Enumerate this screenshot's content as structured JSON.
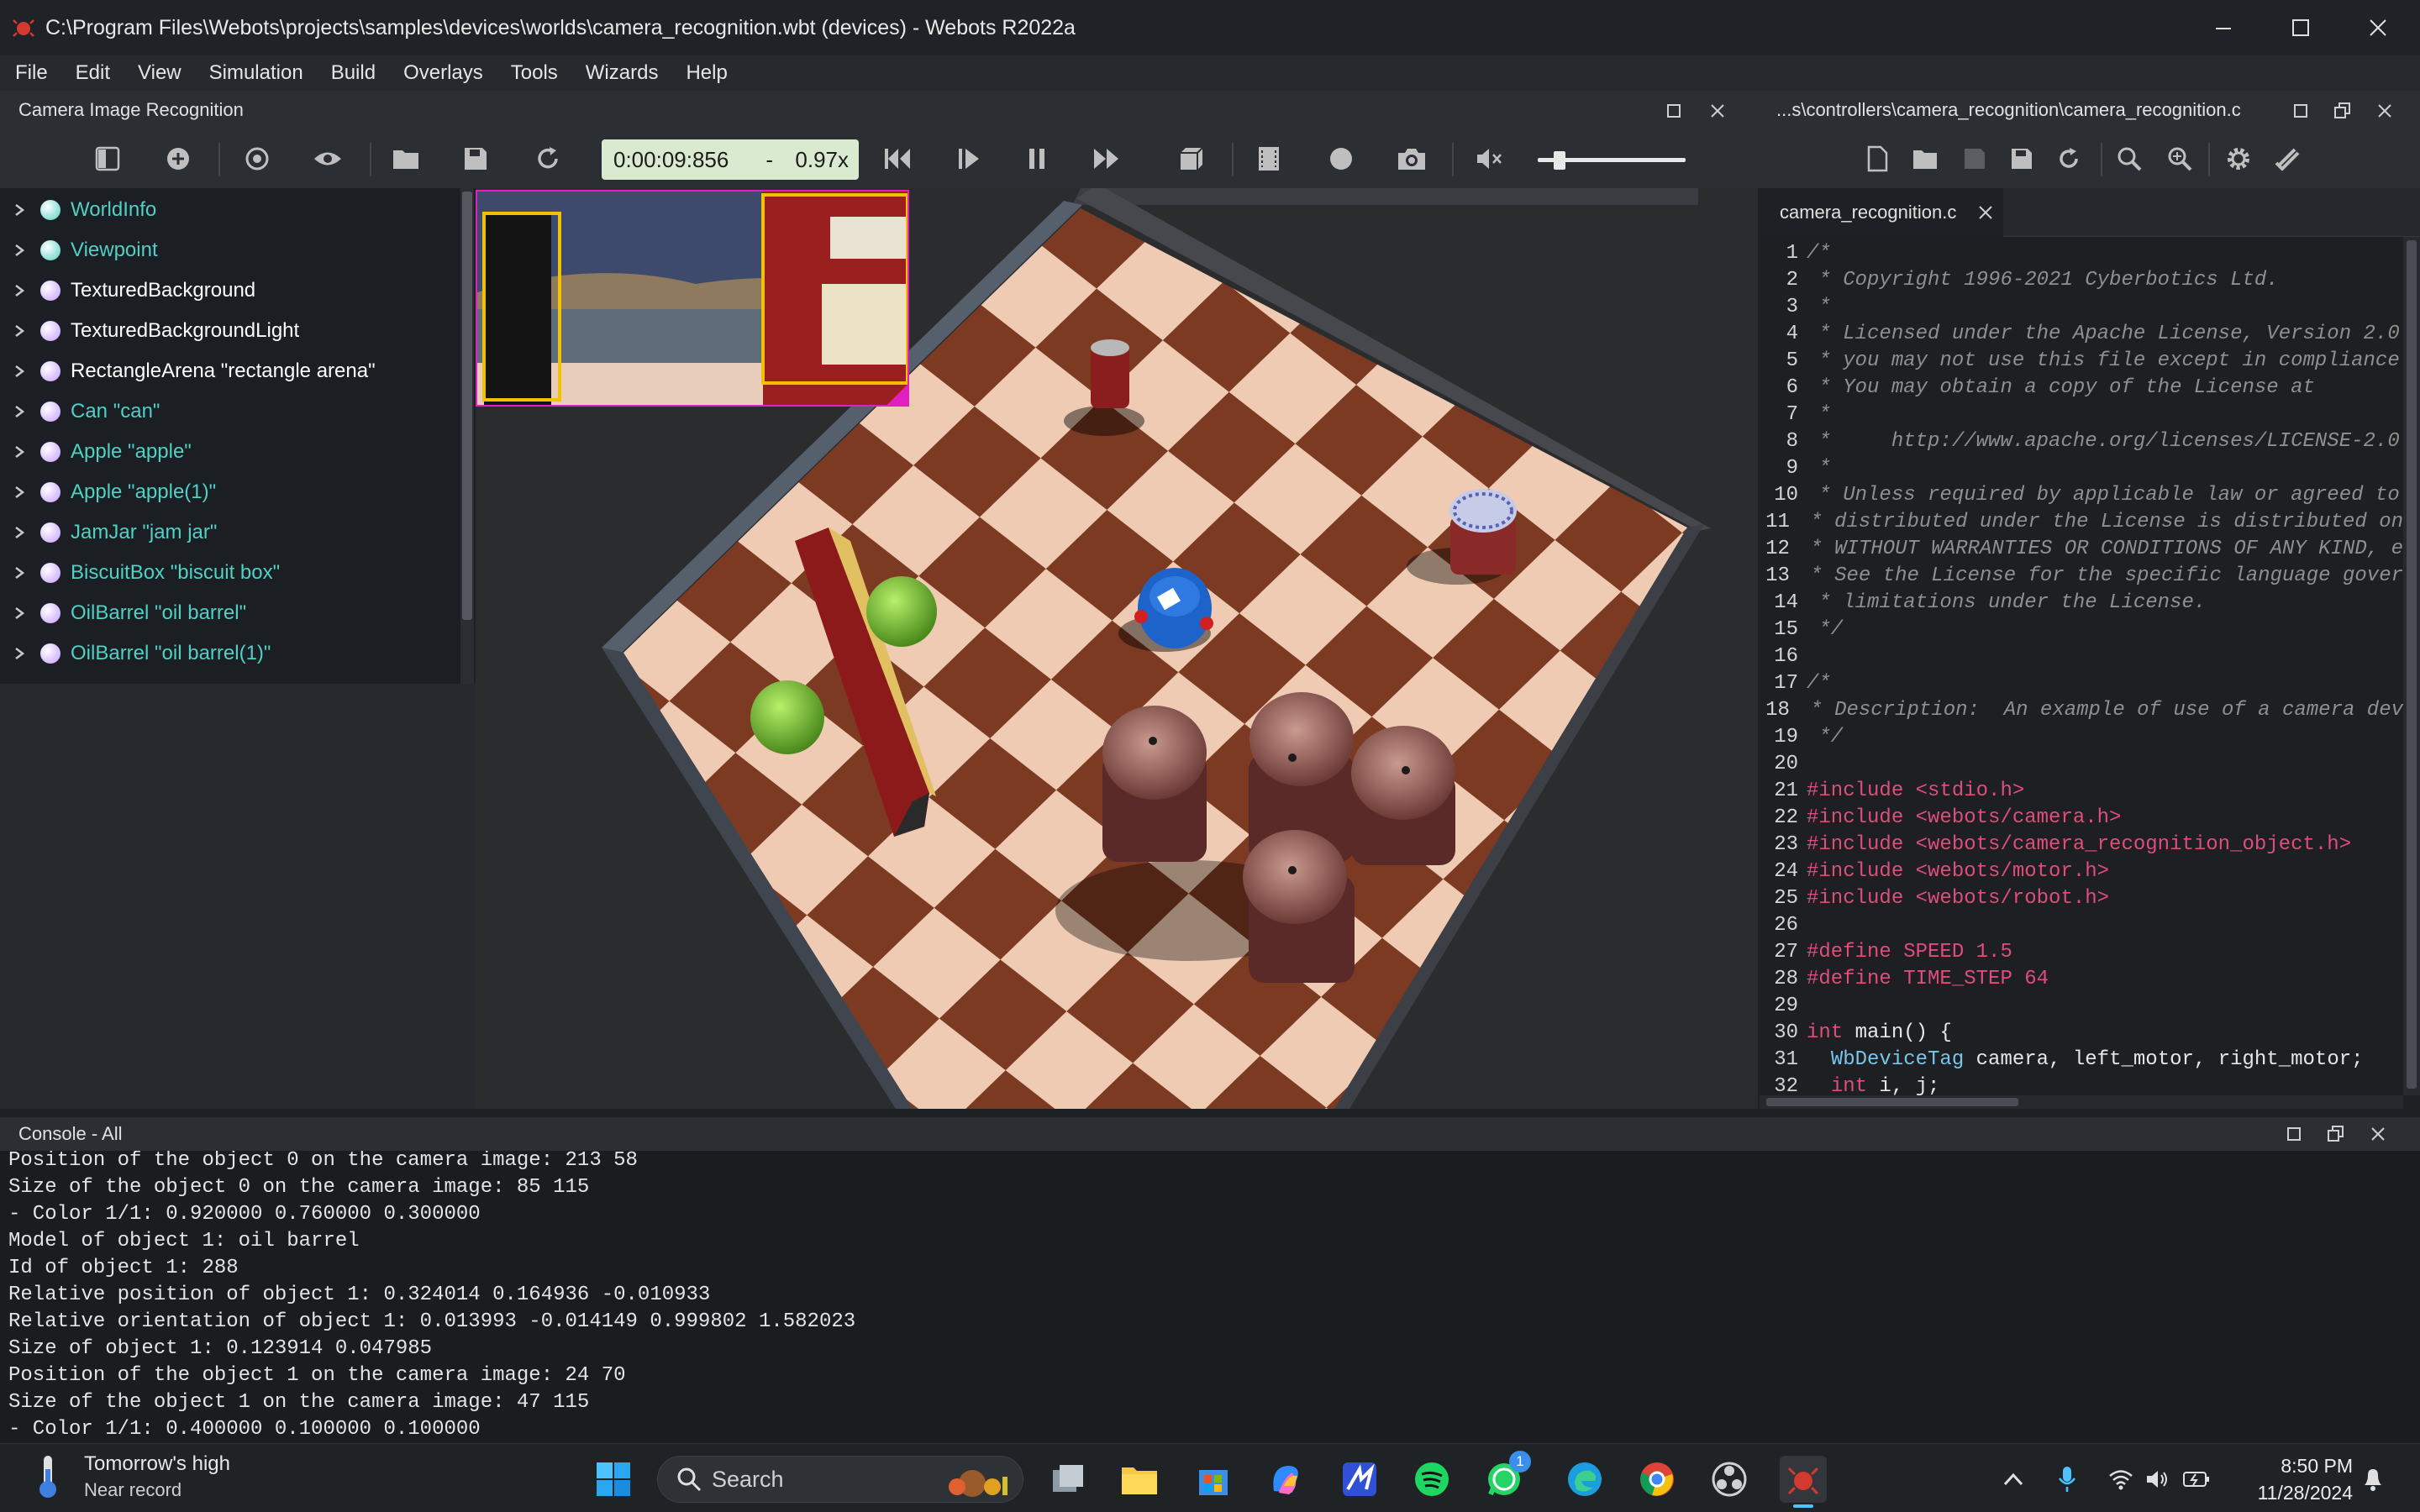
{
  "window": {
    "title": "C:\\Program Files\\Webots\\projects\\samples\\devices\\worlds\\camera_recognition.wbt (devices) - Webots R2022a"
  },
  "menu": [
    "File",
    "Edit",
    "View",
    "Simulation",
    "Build",
    "Overlays",
    "Tools",
    "Wizards",
    "Help"
  ],
  "viewer_panel": {
    "title": "Camera Image Recognition"
  },
  "editor_panel": {
    "title": "...s\\controllers\\camera_recognition\\camera_recognition.c"
  },
  "simulation": {
    "time": "0:00:09:856",
    "separator": "-",
    "speed": "0.97x",
    "volume_level": 0.12
  },
  "scene_tree": [
    {
      "label": "WorldInfo",
      "color": "#4fd1c5"
    },
    {
      "label": "Viewpoint",
      "color": "#4fd1c5"
    },
    {
      "label": "TexturedBackground",
      "color": "#ffffff"
    },
    {
      "label": "TexturedBackgroundLight",
      "color": "#ffffff"
    },
    {
      "label": "RectangleArena \"rectangle arena\"",
      "color": "#ffffff"
    },
    {
      "label": "Can \"can\"",
      "color": "#4fd1c5"
    },
    {
      "label": "Apple \"apple\"",
      "color": "#4fd1c5"
    },
    {
      "label": "Apple \"apple(1)\"",
      "color": "#4fd1c5"
    },
    {
      "label": "JamJar \"jam jar\"",
      "color": "#4fd1c5"
    },
    {
      "label": "BiscuitBox \"biscuit box\"",
      "color": "#4fd1c5"
    },
    {
      "label": "OilBarrel \"oil barrel\"",
      "color": "#4fd1c5"
    },
    {
      "label": "OilBarrel \"oil barrel(1)\"",
      "color": "#4fd1c5"
    },
    {
      "label": "OilBarrel \"oil barrel(2)\"",
      "color": "#4fd1c5"
    }
  ],
  "editor": {
    "tab": "camera_recognition.c",
    "lines": [
      {
        "n": "1",
        "t": "/*",
        "k": "comment"
      },
      {
        "n": "2",
        "t": " * Copyright 1996-2021 Cyberbotics Ltd.",
        "k": "comment"
      },
      {
        "n": "3",
        "t": " *",
        "k": "comment"
      },
      {
        "n": "4",
        "t": " * Licensed under the Apache License, Version 2.0",
        "k": "comment"
      },
      {
        "n": "5",
        "t": " * you may not use this file except in compliance",
        "k": "comment"
      },
      {
        "n": "6",
        "t": " * You may obtain a copy of the License at",
        "k": "comment"
      },
      {
        "n": "7",
        "t": " *",
        "k": "comment"
      },
      {
        "n": "8",
        "t": " *     http://www.apache.org/licenses/LICENSE-2.0",
        "k": "comment"
      },
      {
        "n": "9",
        "t": " *",
        "k": "comment"
      },
      {
        "n": "10",
        "t": " * Unless required by applicable law or agreed to",
        "k": "comment"
      },
      {
        "n": "11",
        "t": " * distributed under the License is distributed on",
        "k": "comment"
      },
      {
        "n": "12",
        "t": " * WITHOUT WARRANTIES OR CONDITIONS OF ANY KIND, e",
        "k": "comment"
      },
      {
        "n": "13",
        "t": " * See the License for the specific language gover",
        "k": "comment"
      },
      {
        "n": "14",
        "t": " * limitations under the License.",
        "k": "comment"
      },
      {
        "n": "15",
        "t": " */",
        "k": "comment"
      },
      {
        "n": "16",
        "t": "",
        "k": "text"
      },
      {
        "n": "17",
        "t": "/*",
        "k": "comment"
      },
      {
        "n": "18",
        "t": " * Description:  An example of use of a camera dev",
        "k": "comment"
      },
      {
        "n": "19",
        "t": " */",
        "k": "comment"
      },
      {
        "n": "20",
        "t": "",
        "k": "text"
      },
      {
        "n": "21",
        "t": "#include <stdio.h>",
        "k": "pre"
      },
      {
        "n": "22",
        "t": "#include <webots/camera.h>",
        "k": "pre"
      },
      {
        "n": "23",
        "t": "#include <webots/camera_recognition_object.h>",
        "k": "pre"
      },
      {
        "n": "24",
        "t": "#include <webots/motor.h>",
        "k": "pre"
      },
      {
        "n": "25",
        "t": "#include <webots/robot.h>",
        "k": "pre"
      },
      {
        "n": "26",
        "t": "",
        "k": "text"
      },
      {
        "n": "27",
        "t": "#define SPEED 1.5",
        "k": "pre"
      },
      {
        "n": "28",
        "t": "#define TIME_STEP 64",
        "k": "pre"
      },
      {
        "n": "29",
        "t": "",
        "k": "text"
      },
      {
        "n": "30",
        "t": "int main() {",
        "k": "main"
      },
      {
        "n": "31",
        "t": "  WbDeviceTag camera, left_motor, right_motor;",
        "k": "decl"
      },
      {
        "n": "32",
        "t": "  int i, j;",
        "k": "int"
      }
    ]
  },
  "console": {
    "title": "Console - All",
    "lines": [
      "Position of the object 0 on the camera image: 213 58",
      "Size of the object 0 on the camera image: 85 115",
      "- Color 1/1: 0.920000 0.760000 0.300000",
      "Model of object 1: oil barrel",
      "Id of object 1: 288",
      "Relative position of object 1: 0.324014 0.164936 -0.010933",
      "Relative orientation of object 1: 0.013993 -0.014149 0.999802 1.582023",
      "Size of object 1: 0.123914 0.047985",
      "Position of the object 1 on the camera image: 24 70",
      "Size of the object 1 on the camera image: 47 115",
      "- Color 1/1: 0.400000 0.100000 0.100000"
    ]
  },
  "taskbar": {
    "weather_line1": "Tomorrow's high",
    "weather_line2": "Near record",
    "search_label": "Search",
    "whatsapp_badge": "1",
    "time": "8:50 PM",
    "date": "11/28/2024"
  },
  "colors": {
    "accent": "#4fd1c5",
    "clock_bg": "#d9ead0",
    "recognition_box": "#f2c200",
    "overlay_border": "#e020c0"
  }
}
